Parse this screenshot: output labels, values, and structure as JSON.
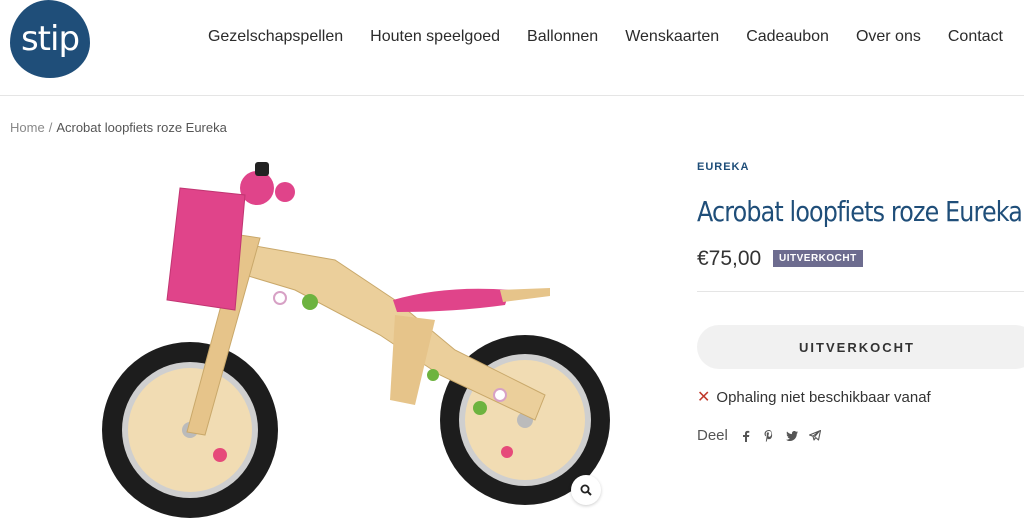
{
  "header": {
    "logo_text": "stip",
    "nav": [
      "Gezelschapspellen",
      "Houten speelgoed",
      "Ballonnen",
      "Wenskaarten",
      "Cadeaubon",
      "Over ons",
      "Contact"
    ]
  },
  "breadcrumb": {
    "home": "Home",
    "separator": "/",
    "current": "Acrobat loopfiets roze Eureka"
  },
  "product": {
    "brand": "EUREKA",
    "title": "Acrobat loopfiets roze Eureka",
    "price": "€75,00",
    "badge": "UITVERKOCHT",
    "button_label": "UITVERKOCHT",
    "pickup_text": "Ophaling niet beschikbaar vanaf",
    "pickup_icon": "x-icon",
    "share_label": "Deel",
    "share_icons": [
      "facebook-icon",
      "pinterest-icon",
      "twitter-icon",
      "telegram-icon"
    ]
  },
  "colors": {
    "brand_blue": "#1f4e79",
    "badge_bg": "#6d6c8f",
    "pink": "#e0448a"
  }
}
